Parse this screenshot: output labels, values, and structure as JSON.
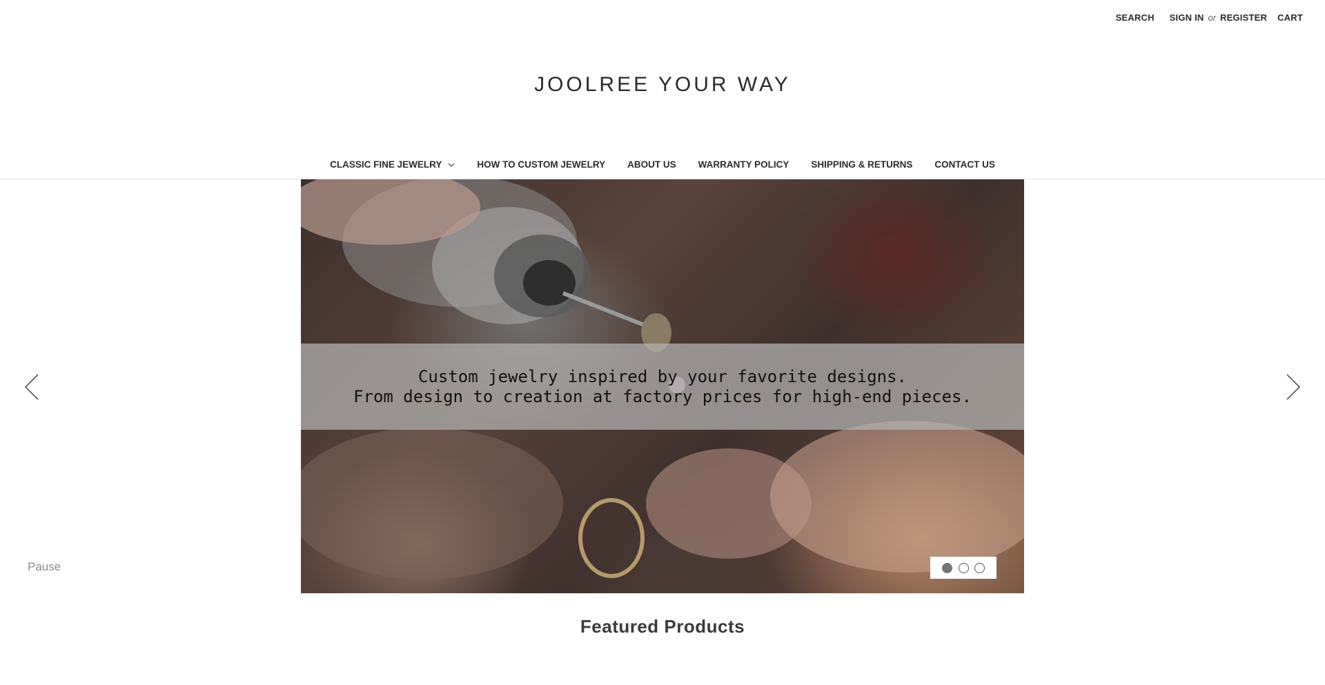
{
  "header": {
    "search_label": "SEARCH",
    "sign_in_label": "SIGN IN",
    "or_text": "or",
    "register_label": "REGISTER",
    "cart_label": "CART"
  },
  "logo_text": "JOOLREE YOUR WAY",
  "nav": {
    "items": [
      {
        "label": "CLASSIC FINE JEWELRY",
        "has_dropdown": true,
        "icon": "chevron-down-icon"
      },
      {
        "label": "HOW TO CUSTOM JEWELRY"
      },
      {
        "label": "ABOUT US"
      },
      {
        "label": "WARRANTY POLICY"
      },
      {
        "label": "SHIPPING & RETURNS"
      },
      {
        "label": "CONTACT US"
      }
    ]
  },
  "carousel": {
    "caption_line1": "Custom jewelry inspired by your favorite designs.",
    "caption_line2": "From design to creation at factory prices for high-end pieces.",
    "slide_count": 3,
    "active_slide": 1,
    "pause_label": "Pause",
    "prev_icon": "chevron-left-icon",
    "next_icon": "chevron-right-icon",
    "image_subject": "jeweler-hands-polishing-ring-photo"
  },
  "featured_title": "Featured Products",
  "colors": {
    "text": "#2b2b2b",
    "caption_overlay": "#b4b4b4",
    "dot_active": "#757575",
    "pause_text": "#8a8a8a",
    "divider": "#e3e3e3"
  }
}
